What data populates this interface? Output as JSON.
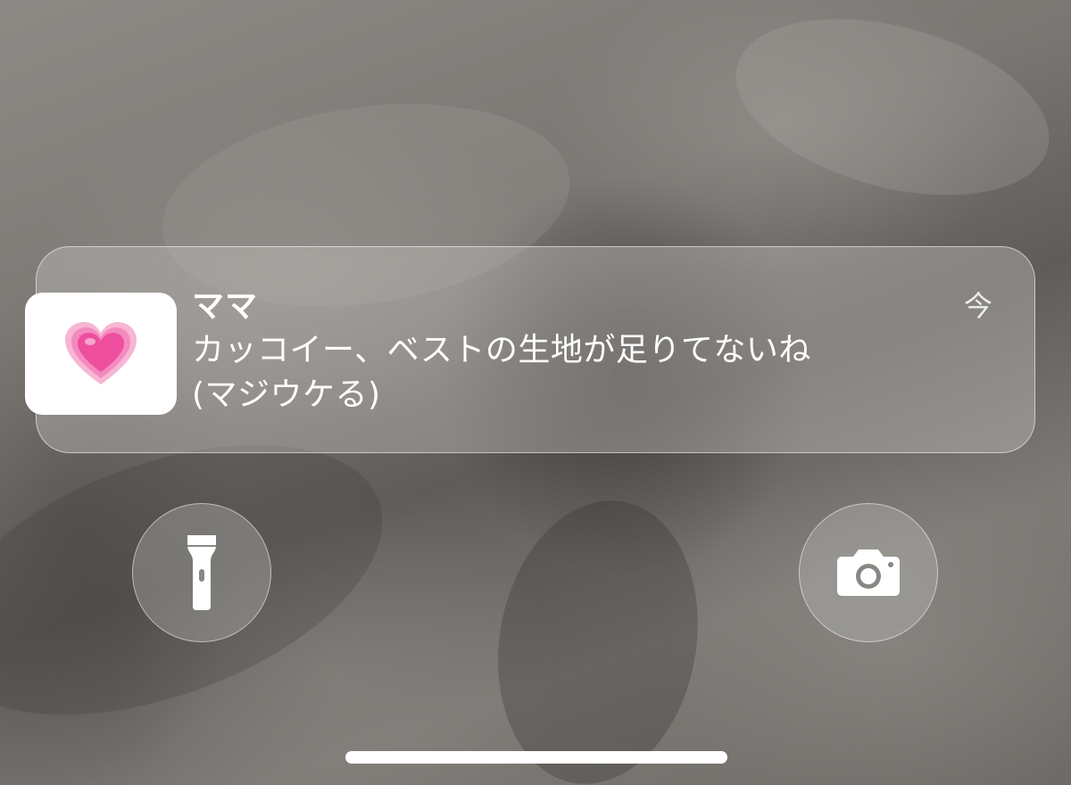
{
  "notification": {
    "title": "ママ",
    "time": "今",
    "message_line1": "カッコイー、ベストの生地が足りてないね",
    "message_line2": "(マジウケる)",
    "app_icon": "growing-heart-emoji",
    "icon_color": "#f0509a"
  },
  "buttons": {
    "flashlight": {
      "icon": "flashlight-icon"
    },
    "camera": {
      "icon": "camera-icon"
    }
  },
  "colors": {
    "wallpaper": "#7a7773",
    "text": "#ffffff"
  }
}
